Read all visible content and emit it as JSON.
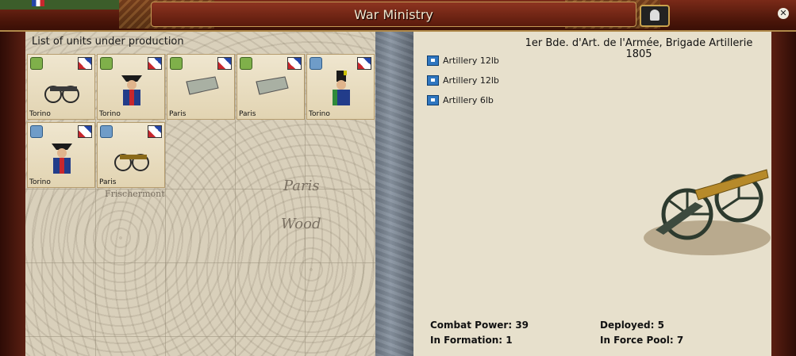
{
  "window": {
    "title": "War Ministry"
  },
  "left_panel": {
    "title": "List of units under production",
    "slots": [
      {
        "location": "Torino",
        "badge_color": "green",
        "kind": "cannon"
      },
      {
        "location": "Torino",
        "badge_color": "green",
        "kind": "artilleryman"
      },
      {
        "location": "Paris",
        "badge_color": "green",
        "kind": "supply"
      },
      {
        "location": "Paris",
        "badge_color": "green",
        "kind": "supply"
      },
      {
        "location": "Torino",
        "badge_color": "blue",
        "kind": "light-infantry"
      },
      {
        "location": "Torino",
        "badge_color": "blue",
        "kind": "artilleryman"
      },
      {
        "location": "Paris",
        "badge_color": "blue",
        "kind": "cannon"
      }
    ],
    "map_labels": [
      "Frischermont",
      "Paris",
      "Wood"
    ]
  },
  "right_panel": {
    "brigade_name_line1": "1er Bde. d'Art. de l'Armée, Brigade Artillerie",
    "brigade_name_line2": "1805",
    "units": [
      {
        "name": "Artillery 12lb"
      },
      {
        "name": "Artillery 12lb"
      },
      {
        "name": "Artillery 6lb"
      }
    ],
    "stats": {
      "combat_power": "Combat Power: 39",
      "in_formation": "In Formation: 1",
      "deployed": "Deployed: 5",
      "in_force_pool": "In Force Pool: 7"
    }
  },
  "colors": {
    "frame": "#5a1f12",
    "gold": "#c49a55",
    "unit_icon": "#2f76c0"
  }
}
